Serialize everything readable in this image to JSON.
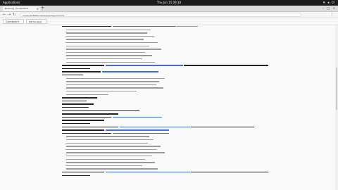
{
  "topbar": {
    "apps_label": "Applications",
    "clock": "Thu Jun 15  09:18",
    "tray_icons": [
      "network-icon",
      "volume-icon",
      "power-icon"
    ]
  },
  "browser": {
    "tab_title": "Build log | Continuous Integration",
    "new_tab": "+",
    "window_controls": [
      "–",
      "□",
      "×"
    ],
    "url": "localhost:8080/ci/build/job/logs/console",
    "bookmarks": [
      "Dashboard",
      "demo-app"
    ]
  },
  "log_lines": [
    {
      "indent": 0,
      "parts": [
        [
          "dark",
          70
        ],
        [
          "blue",
          90
        ],
        [
          "gray",
          30
        ]
      ]
    },
    {
      "indent": 6,
      "parts": [
        [
          "gray",
          120
        ]
      ]
    },
    {
      "indent": 6,
      "parts": [
        [
          "gray",
          115
        ]
      ]
    },
    {
      "indent": 6,
      "parts": [
        [
          "gray",
          125
        ]
      ]
    },
    {
      "indent": 6,
      "parts": [
        [
          "gray",
          110
        ]
      ]
    },
    {
      "indent": 6,
      "parts": [
        [
          "gray",
          130
        ]
      ]
    },
    {
      "indent": 6,
      "parts": [
        [
          "gray",
          118
        ]
      ]
    },
    {
      "indent": 6,
      "parts": [
        [
          "gray",
          135
        ]
      ]
    },
    {
      "indent": 6,
      "parts": [
        [
          "gray",
          112
        ]
      ]
    },
    {
      "indent": 6,
      "parts": [
        [
          "gray",
          122
        ]
      ]
    },
    {
      "indent": 6,
      "parts": [
        [
          "gray",
          108
        ]
      ]
    },
    {
      "indent": 6,
      "parts": [
        [
          "gray",
          126
        ]
      ]
    },
    {
      "indent": 0,
      "parts": [
        [
          "dark",
          60
        ],
        [
          "blue",
          110
        ],
        [
          "dark",
          120
        ]
      ]
    },
    {
      "indent": 0,
      "parts": [
        [
          "dark",
          40
        ]
      ]
    },
    {
      "indent": 0,
      "parts": [
        [
          "dark",
          55
        ],
        [
          "blue",
          80
        ]
      ]
    },
    {
      "indent": 0,
      "parts": [
        [
          "dark",
          30
        ]
      ]
    },
    {
      "indent": 6,
      "parts": [
        [
          "gray",
          140
        ]
      ]
    },
    {
      "indent": 6,
      "parts": [
        [
          "gray",
          132
        ]
      ]
    },
    {
      "indent": 6,
      "parts": [
        [
          "gray",
          128
        ]
      ]
    },
    {
      "indent": 6,
      "parts": [
        [
          "gray",
          138
        ]
      ]
    },
    {
      "indent": 6,
      "parts": [
        [
          "gray",
          100
        ]
      ]
    },
    {
      "indent": 6,
      "parts": [
        [
          "gray",
          60
        ]
      ]
    },
    {
      "indent": 0,
      "parts": [
        [
          "dark",
          50
        ]
      ]
    },
    {
      "indent": 0,
      "parts": [
        [
          "dark",
          35
        ]
      ]
    },
    {
      "indent": 0,
      "parts": [
        [
          "dark",
          45
        ]
      ]
    },
    {
      "indent": 0,
      "parts": [
        [
          "dark",
          38
        ]
      ]
    },
    {
      "indent": 0,
      "parts": [
        [
          "dark",
          110
        ]
      ]
    },
    {
      "indent": 0,
      "parts": [
        [
          "dark",
          80
        ]
      ]
    },
    {
      "indent": 0,
      "parts": [
        [
          "dark",
          70
        ],
        [
          "blue",
          70
        ]
      ]
    },
    {
      "indent": 0,
      "parts": [
        [
          "dark",
          60
        ]
      ]
    },
    {
      "indent": 0,
      "parts": [
        [
          "dark",
          40
        ]
      ]
    },
    {
      "indent": 0,
      "parts": [
        [
          "dark",
          80
        ],
        [
          "blue",
          100
        ],
        [
          "dark",
          90
        ]
      ]
    },
    {
      "indent": 0,
      "parts": [
        [
          "dark",
          60
        ],
        [
          "blue",
          90
        ]
      ]
    },
    {
      "indent": 0,
      "parts": [
        [
          "dark",
          70
        ],
        [
          "blue",
          80
        ]
      ]
    },
    {
      "indent": 6,
      "parts": [
        [
          "gray",
          118
        ]
      ]
    },
    {
      "indent": 6,
      "parts": [
        [
          "gray",
          124
        ]
      ]
    },
    {
      "indent": 6,
      "parts": [
        [
          "gray",
          116
        ]
      ]
    },
    {
      "indent": 6,
      "parts": [
        [
          "gray",
          134
        ]
      ]
    },
    {
      "indent": 6,
      "parts": [
        [
          "gray",
          128
        ]
      ]
    },
    {
      "indent": 6,
      "parts": [
        [
          "gray",
          140
        ]
      ]
    },
    {
      "indent": 6,
      "parts": [
        [
          "gray",
          122
        ]
      ]
    },
    {
      "indent": 6,
      "parts": [
        [
          "gray",
          112
        ]
      ]
    },
    {
      "indent": 6,
      "parts": [
        [
          "gray",
          126
        ]
      ]
    },
    {
      "indent": 6,
      "parts": [
        [
          "gray",
          108
        ]
      ]
    },
    {
      "indent": 6,
      "parts": [
        [
          "gray",
          130
        ]
      ]
    },
    {
      "indent": 0,
      "parts": [
        [
          "dark",
          60
        ],
        [
          "blue",
          120
        ],
        [
          "dark",
          110
        ]
      ]
    },
    {
      "indent": 0,
      "parts": [
        [
          "dark",
          40
        ]
      ]
    }
  ]
}
